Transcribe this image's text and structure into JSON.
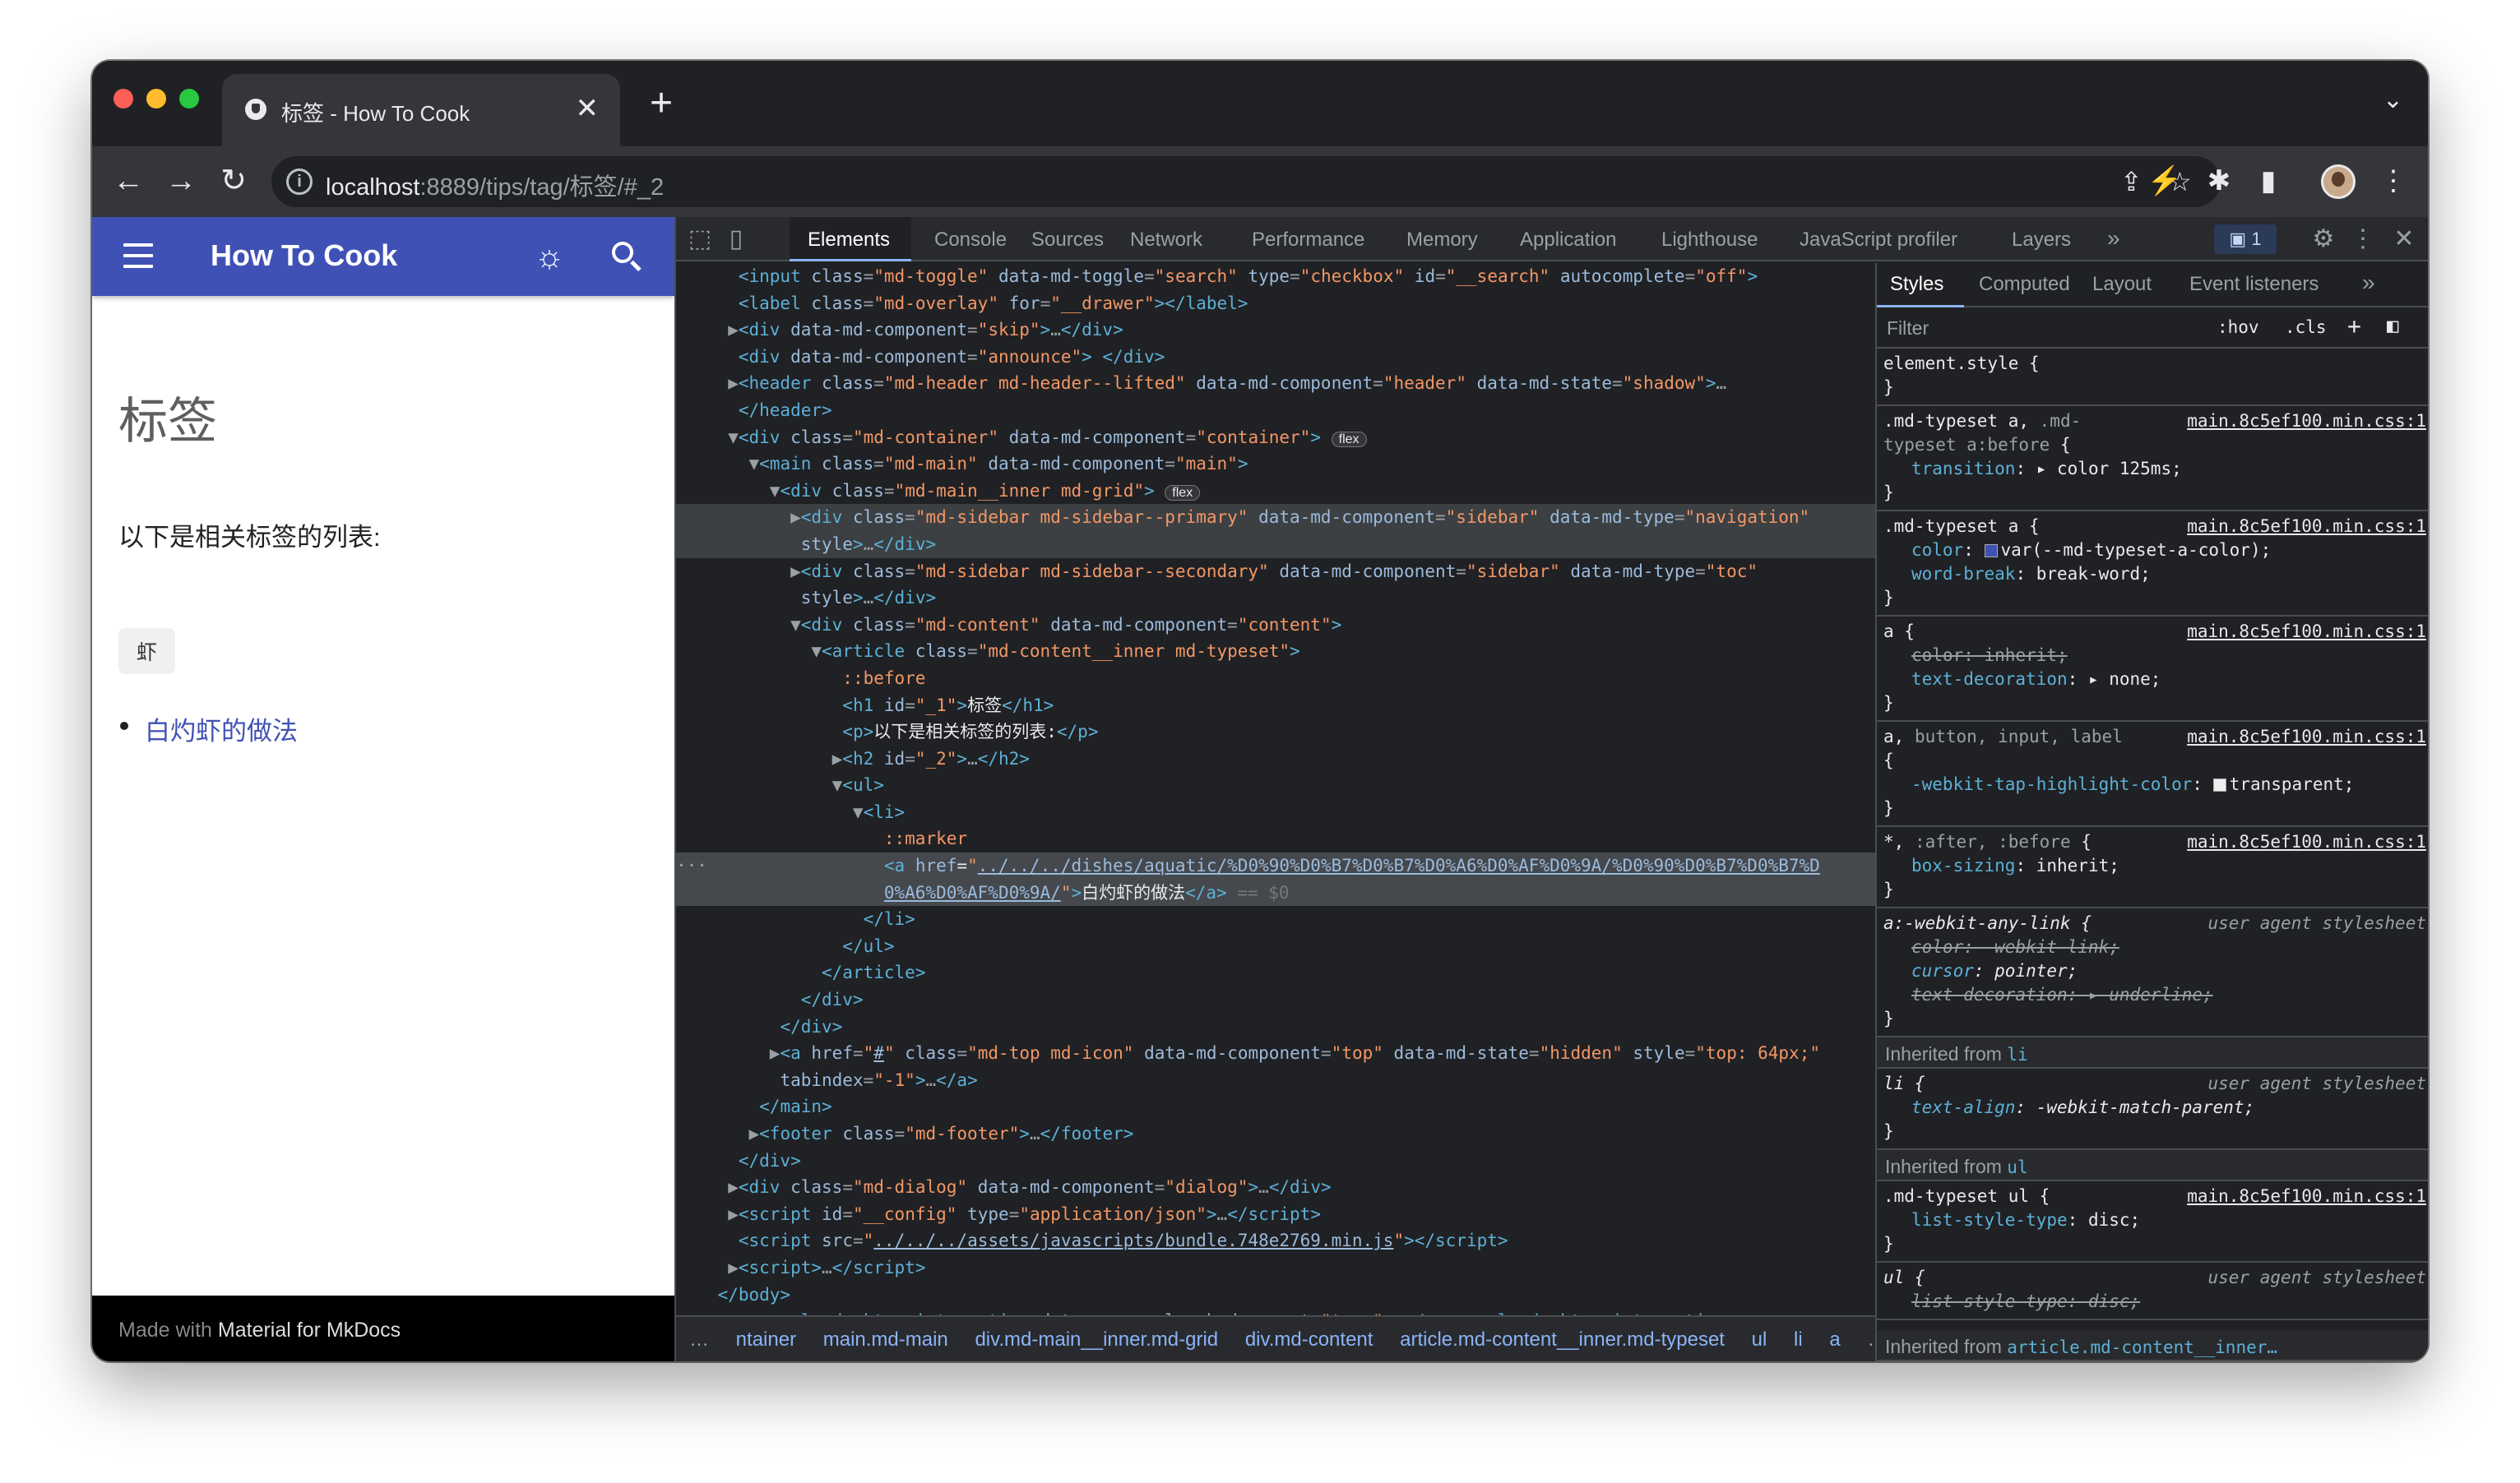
{
  "browser": {
    "tab_title": "标签 - How To Cook",
    "tab_close": "✕",
    "new_tab": "+",
    "url_host": "localhost",
    "url_rest": ":8889/tips/tag/标签/#_2"
  },
  "page": {
    "site_name": "How To Cook",
    "heading": "标签",
    "intro": "以下是相关标签的列表:",
    "tag": "虾",
    "list_items": [
      "白灼虾的做法"
    ],
    "footer_prefix": "Made with ",
    "footer_link": "Material for MkDocs"
  },
  "devtools": {
    "tabs": [
      "Elements",
      "Console",
      "Sources",
      "Network",
      "Performance",
      "Memory",
      "Application",
      "Lighthouse",
      "JavaScript profiler",
      "Layers"
    ],
    "more": "»",
    "issues_count": "1",
    "breadcrumbs": [
      "…",
      "ntainer",
      "main.md-main",
      "div.md-main__inner.md-grid",
      "div.md-content",
      "article.md-content__inner.md-typeset",
      "ul",
      "li",
      "a",
      "…"
    ],
    "styles_tabs": [
      "Styles",
      "Computed",
      "Layout",
      "Event listeners"
    ],
    "filter_placeholder": "Filter",
    "hov": ":hov",
    "cls": ".cls",
    "plus": "+",
    "inherited_li_label": "Inherited from ",
    "inherited_li": "li",
    "inherited_ul_label": "Inherited from ",
    "inherited_ul": "ul",
    "inherited_article_label": "Inherited from ",
    "inherited_article": "article.md-content__inner…",
    "css_source": "main.8c5ef100.min.css:1",
    "user_agent": "user agent stylesheet"
  },
  "colors": {
    "md_primary": "#4051b5",
    "chrome_dark": "#202124",
    "chrome_toolbar": "#35363a",
    "traffic_red": "#ff5f57",
    "traffic_yellow": "#febc2e",
    "traffic_green": "#28c840"
  }
}
